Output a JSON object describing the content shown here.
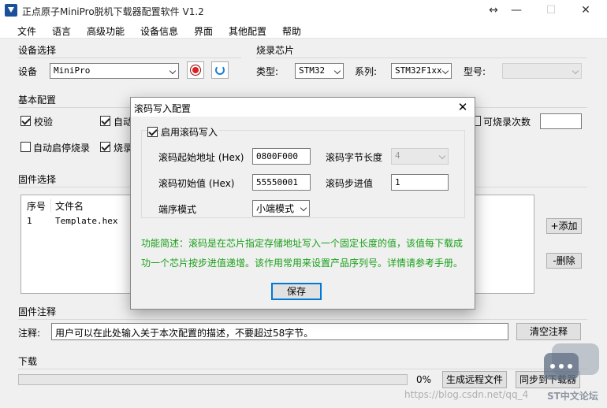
{
  "window": {
    "title": "正点原子MiniPro脱机下载器配置软件 V1.2",
    "controls": {
      "extra": "↔",
      "minimize": "—",
      "maximize": "☐",
      "close": "✕"
    }
  },
  "menu": [
    "文件",
    "语言",
    "高级功能",
    "设备信息",
    "界面",
    "其他配置",
    "帮助"
  ],
  "device_select": {
    "group_label": "设备选择",
    "label": "设备",
    "value": "MiniPro"
  },
  "chip": {
    "group_label": "烧录芯片",
    "type_label": "类型:",
    "type_value": "STM32",
    "series_label": "系列:",
    "series_value": "STM32F1xx",
    "model_label": "型号:",
    "model_value": ""
  },
  "basic_config": {
    "group_label": "基本配置",
    "checkboxes": {
      "verify": {
        "label": "校验",
        "checked": true
      },
      "auto_partial": {
        "label": "自动",
        "checked": true
      },
      "burn_count_limit": {
        "label": "可烧录次数",
        "checked": false
      },
      "auto_start": {
        "label": "自动启停烧录",
        "checked": false
      },
      "burn_partial": {
        "label": "烧录",
        "checked": true
      }
    },
    "burn_count_value": ""
  },
  "firmware": {
    "group_label": "固件选择",
    "columns": [
      "序号",
      "文件名"
    ],
    "rows": [
      {
        "index": "1",
        "filename": "Template.hex"
      }
    ],
    "add_button": "+添加",
    "delete_button": "-删除"
  },
  "firmware_note": {
    "group_label": "固件注释",
    "label": "注释:",
    "value": "用户可以在此处输入关于本次配置的描述，不要超过58字节。",
    "clear_button": "清空注释"
  },
  "download": {
    "group_label": "下载",
    "progress_percent": 0,
    "progress_text": "0%",
    "generate_button": "生成远程文件",
    "sync_button": "同步到下载器"
  },
  "watermark": {
    "url": "https://blog.csdn.net/qq_4",
    "forum": "ST中文论坛"
  },
  "dialog": {
    "title": "滚码写入配置",
    "enable": {
      "label": "启用滚码写入",
      "checked": true
    },
    "start_addr_label": "滚码起始地址 (Hex)",
    "start_addr_value": "0800F000",
    "byte_len_label": "滚码字节长度",
    "byte_len_value": "4",
    "init_value_label": "滚码初始值 (Hex)",
    "init_value": "55550001",
    "step_label": "滚码步进值",
    "step_value": "1",
    "endian_label": "端序模式",
    "endian_value": "小端模式",
    "desc_line1": "功能简述：滚码是在芯片指定存储地址写入一个固定长度的值，该值每下载成",
    "desc_line2": "功一个芯片按步进值递增。该作用常用来设置产品序列号。详情请参考手册。",
    "save_button": "保存"
  },
  "colors": {
    "accent_green": "#18a018",
    "record_red": "#e02020",
    "refresh_blue": "#1e7fd8"
  }
}
